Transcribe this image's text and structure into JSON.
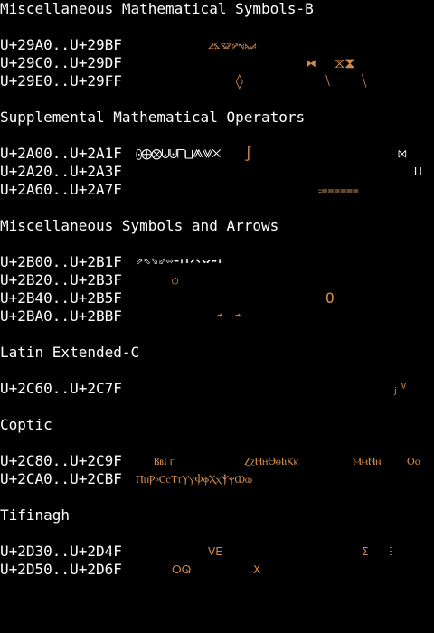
{
  "colors": {
    "background": "#000000",
    "text": "#ffffff",
    "glyph": "#d08a4c"
  },
  "blocks": {
    "misc_math_b": {
      "title": "Miscellaneous Mathematical Symbols-B",
      "rows": [
        {
          "range": "U+29A0..U+29BF",
          "glyphs": [
            "⦨⦩⦪⦫⦬⦭⦮⦯"
          ]
        },
        {
          "range": "U+29C0..U+29DF",
          "glyphs": [
            "⧓",
            "⧖⧗"
          ]
        },
        {
          "range": "U+29E0..U+29FF",
          "glyphs": [
            "◊",
            "⧵",
            "⧹"
          ]
        }
      ]
    },
    "supp_math_ops": {
      "title": "Supplemental Mathematical Operators",
      "rows": [
        {
          "range": "U+2A00..U+2A1F",
          "glyphs": [
            "⨀⨁⨂⨃⨄⨅⨆⨇⨈⨉",
            "∫",
            "⨝"
          ]
        },
        {
          "range": "U+2A20..U+2A3F",
          "glyphs": [
            "⨿"
          ]
        },
        {
          "range": "U+2A60..U+2A7F",
          "glyphs": [
            "⩴⩵⩶"
          ]
        }
      ]
    },
    "misc_symbols_arrows": {
      "title": "Miscellaneous Symbols and Arrows",
      "rows": [
        {
          "range": "U+2B00..U+2B1F",
          "glyphs": [
            "⬀⬁⬂⬃⬄⬅⬆⬇⬈⬉⬊⬋⬌⬍"
          ]
        },
        {
          "range": "U+2B20..U+2B3F",
          "glyphs": [
            "○"
          ]
        },
        {
          "range": "U+2B40..U+2B5F",
          "glyphs": [
            "O"
          ]
        },
        {
          "range": "U+2BA0..U+2BBF",
          "glyphs": [
            "➜",
            "➜"
          ]
        }
      ]
    },
    "latin_ext_c": {
      "title": "Latin Extended-C",
      "rows": [
        {
          "range": "U+2C60..U+2C7F",
          "glyphs": [
            "ⱼⱽ"
          ]
        }
      ]
    },
    "coptic": {
      "title": "Coptic",
      "rows": [
        {
          "range": "U+2C80..U+2C9F",
          "glyphs": [
            "ⲂⲃⲄⲅ",
            "ⲌⲍⲎⲏⲐⲑⲒⲓⲔⲕ",
            "ⲘⲙⲚⲛ",
            "Ⲟⲟ"
          ]
        },
        {
          "range": "U+2CA0..U+2CBF",
          "glyphs": [
            "ⲠⲡⲢⲣⲤⲥⲦⲧⲨⲩⲪⲫⲬⲭⲮⲯⲰⲱ"
          ]
        }
      ]
    },
    "tifinagh": {
      "title": "Tifinagh",
      "rows": [
        {
          "range": "U+2D30..U+2D4F",
          "glyphs": [
            "ⴸⴹ",
            "ⵉ",
            "ⵗ"
          ]
        },
        {
          "range": "U+2D50..U+2D6F",
          "glyphs": [
            "ⵔⵕ",
            "ⵝ"
          ]
        }
      ]
    }
  }
}
